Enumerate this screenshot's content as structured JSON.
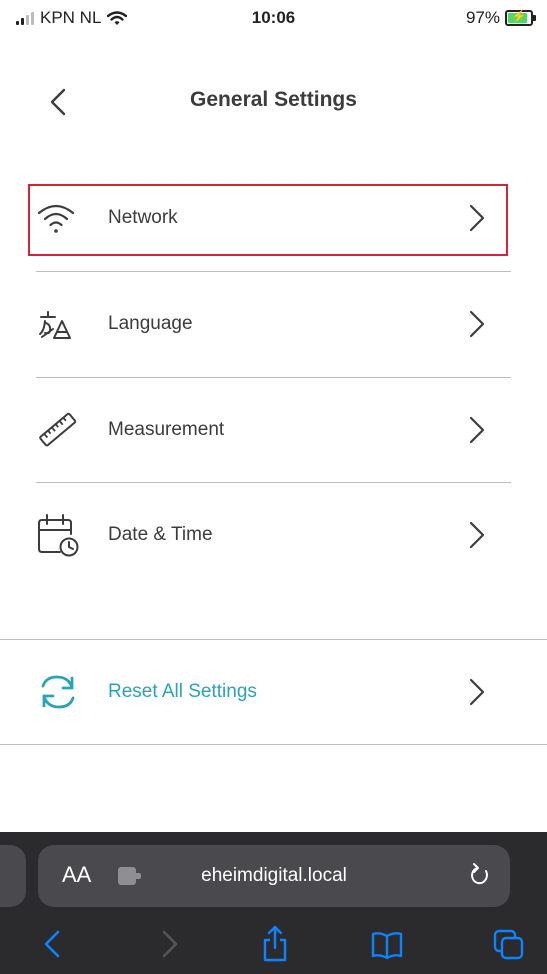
{
  "status_bar": {
    "carrier": "KPN NL",
    "time": "10:06",
    "battery": "97%",
    "battery_level": 0.97
  },
  "header": {
    "title": "General Settings",
    "back_icon": "chevron-left-icon"
  },
  "settings": [
    {
      "label": "Network",
      "icon": "wifi-icon"
    },
    {
      "label": "Language",
      "icon": "translate-icon"
    },
    {
      "label": "Measurement",
      "icon": "ruler-icon"
    },
    {
      "label": "Date & Time",
      "icon": "calendar-clock-icon"
    }
  ],
  "reset": {
    "label": "Reset All Settings",
    "icon": "refresh-icon",
    "color": "#2aa3b8"
  },
  "highlight_color": "#d0253a",
  "browser": {
    "text_size_label": "AA",
    "url": "eheimdigital.local",
    "toolbar_icons": [
      "back-icon",
      "forward-icon",
      "share-icon",
      "bookmarks-icon",
      "tabs-icon"
    ],
    "accent": "#0a84ff"
  }
}
